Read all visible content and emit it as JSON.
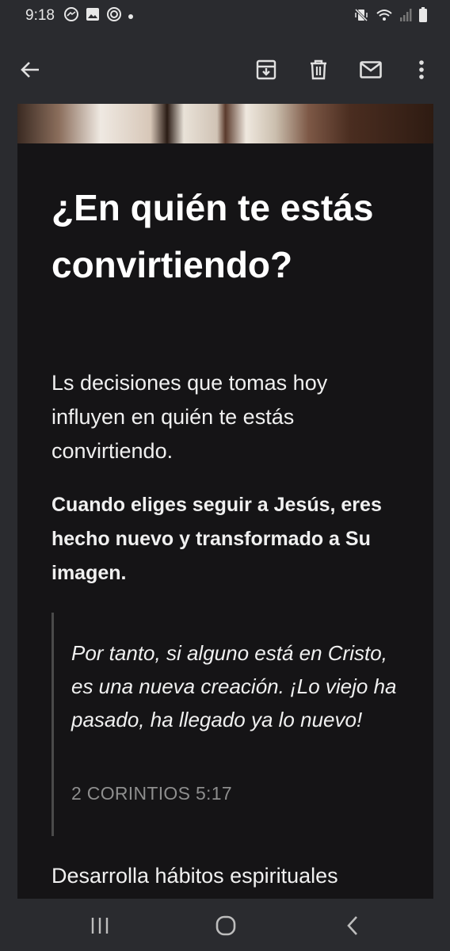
{
  "status_bar": {
    "time": "9:18",
    "left_icons": [
      "messenger-icon",
      "gallery-icon",
      "data-saver-icon"
    ],
    "right_icons": [
      "vibrate-icon",
      "wifi-icon",
      "signal-icon",
      "battery-icon"
    ]
  },
  "toolbar": {
    "icons": [
      "back-arrow-icon",
      "archive-icon",
      "delete-icon",
      "mark-unread-icon",
      "more-options-icon"
    ]
  },
  "email": {
    "headline": "¿En quién te estás convirtiendo?",
    "paragraph_1": "Ls decisiones que tomas hoy influyen en quién te estás convirtiendo.",
    "paragraph_2": "Cuando eliges seguir a Jesús, eres hecho nuevo y transformado a Su imagen.",
    "quote_text": "Por tanto, si alguno está en Cristo, es una nueva creación. ¡Lo viejo ha pasado, ha llegado ya lo nuevo!",
    "quote_reference": "2 CORINTIOS 5:17",
    "paragraph_3": "Desarrolla hábitos espirituales"
  },
  "nav_bar": {
    "icons": [
      "recent-apps-icon",
      "home-icon",
      "back-icon"
    ]
  },
  "colors": {
    "chrome_background": "#2a2b2f",
    "content_background": "#151416",
    "text": "#ffffff",
    "reference_text": "#8e8e8e"
  }
}
